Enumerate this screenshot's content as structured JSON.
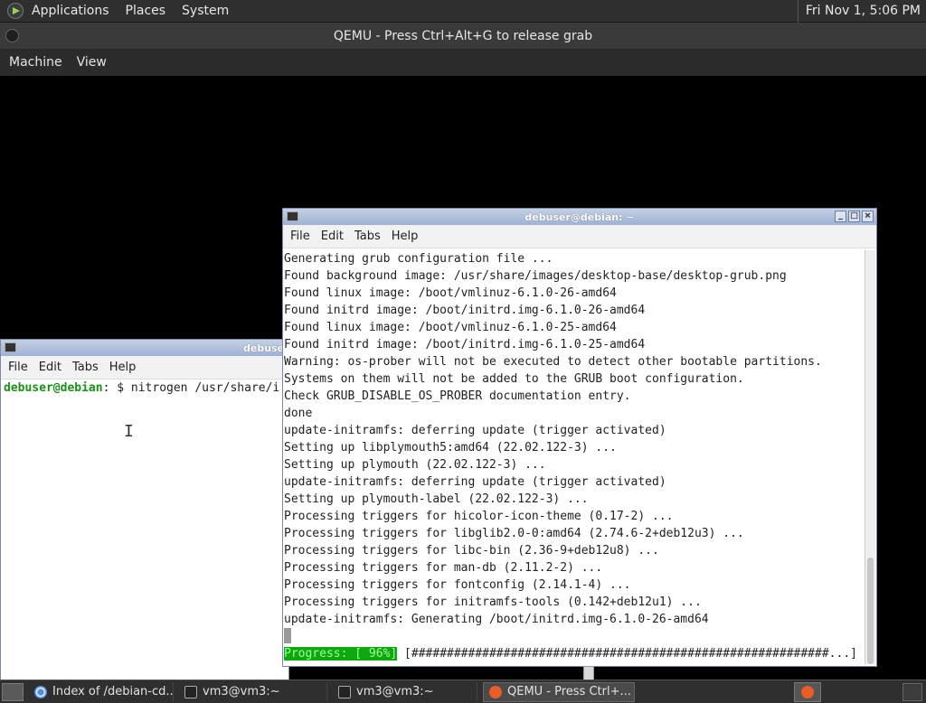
{
  "host_panel": {
    "menus": [
      "Applications",
      "Places",
      "System"
    ],
    "clock": "Fri Nov 1,  5:06 PM"
  },
  "qemu": {
    "title": "QEMU - Press Ctrl+Alt+G to release grab",
    "menus": [
      "Machine",
      "View"
    ]
  },
  "win_left": {
    "title": "debuse",
    "menus": [
      "File",
      "Edit",
      "Tabs",
      "Help"
    ],
    "prompt_user": "debuser@debian",
    "prompt_rest": ": $ nitrogen /usr/share/i"
  },
  "win_right": {
    "title": "debuser@debian: ~",
    "menus": [
      "File",
      "Edit",
      "Tabs",
      "Help"
    ],
    "lines": [
      "Generating grub configuration file ...",
      "Found background image: /usr/share/images/desktop-base/desktop-grub.png",
      "Found linux image: /boot/vmlinuz-6.1.0-26-amd64",
      "Found initrd image: /boot/initrd.img-6.1.0-26-amd64",
      "Found linux image: /boot/vmlinuz-6.1.0-25-amd64",
      "Found initrd image: /boot/initrd.img-6.1.0-25-amd64",
      "Warning: os-prober will not be executed to detect other bootable partitions.",
      "Systems on them will not be added to the GRUB boot configuration.",
      "Check GRUB_DISABLE_OS_PROBER documentation entry.",
      "done",
      "update-initramfs: deferring update (trigger activated)",
      "Setting up libplymouth5:amd64 (22.02.122-3) ...",
      "Setting up plymouth (22.02.122-3) ...",
      "update-initramfs: deferring update (trigger activated)",
      "Setting up plymouth-label (22.02.122-3) ...",
      "Processing triggers for hicolor-icon-theme (0.17-2) ...",
      "Processing triggers for libglib2.0-0:amd64 (2.74.6-2+deb12u3) ...",
      "Processing triggers for libc-bin (2.36-9+deb12u8) ...",
      "Processing triggers for man-db (2.11.2-2) ...",
      "Processing triggers for fontconfig (2.14.1-4) ...",
      "Processing triggers for initramfs-tools (0.142+deb12u1) ...",
      "update-initramfs: Generating /boot/initrd.img-6.1.0-26-amd64"
    ],
    "progress_label": "Progress: [ 96%]",
    "progress_percent": 96,
    "progress_bar": " [###########################################################...]"
  },
  "taskbar": {
    "tasks": [
      {
        "label": "Index of /debian-cd...",
        "icon": "chrome-icon"
      },
      {
        "label": "vm3@vm3:~",
        "icon": "terminal-icon"
      },
      {
        "label": "vm3@vm3:~",
        "icon": "terminal-icon"
      },
      {
        "label": "QEMU - Press Ctrl+...",
        "icon": "qemu-icon"
      }
    ]
  }
}
